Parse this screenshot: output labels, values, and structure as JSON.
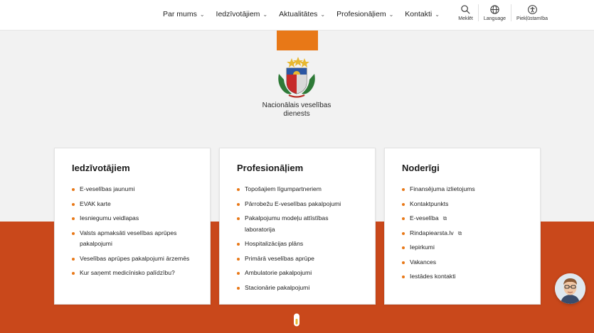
{
  "nav": {
    "items": [
      {
        "label": "Par mums"
      },
      {
        "label": "Iedzīvotājiem"
      },
      {
        "label": "Aktualitātes"
      },
      {
        "label": "Profesionāļiem"
      },
      {
        "label": "Kontakti"
      }
    ]
  },
  "tools": {
    "search": "Meklēt",
    "language": "Language",
    "accessibility": "Piekļūstamība"
  },
  "logo": {
    "line1": "Nacionālais veselības",
    "line2": "dienests"
  },
  "cards": [
    {
      "title": "Iedzīvotājiem",
      "items": [
        "E-veselības jaunumi",
        "EVAK karte",
        "Iesniegumu veidlapas",
        "Valsts apmaksāti veselības aprūpes pakalpojumi",
        "Veselības aprūpes pakalpojumi ārzemēs",
        "Kur saņemt medicīnisko palīdzību?"
      ]
    },
    {
      "title": "Profesionāļiem",
      "items": [
        "Topošajiem līgumpartneriem",
        "Pārrobežu E-veselības pakalpojumi",
        "Pakalpojumu modeļu attīstības laboratorija",
        "Hospitalizācijas plāns",
        "Primārā veselības aprūpe",
        "Ambulatorie pakalpojumi",
        "Stacionārie pakalpojumi"
      ]
    },
    {
      "title": "Noderīgi",
      "items": [
        "Finansējuma izlietojums",
        "Kontaktpunkts",
        "E-veselība",
        "Rindapiearsta.lv",
        "Iepirkumi",
        "Vakances",
        "Iestādes kontakti"
      ]
    }
  ],
  "colors": {
    "accent": "#e87817",
    "band": "#c9481b"
  }
}
